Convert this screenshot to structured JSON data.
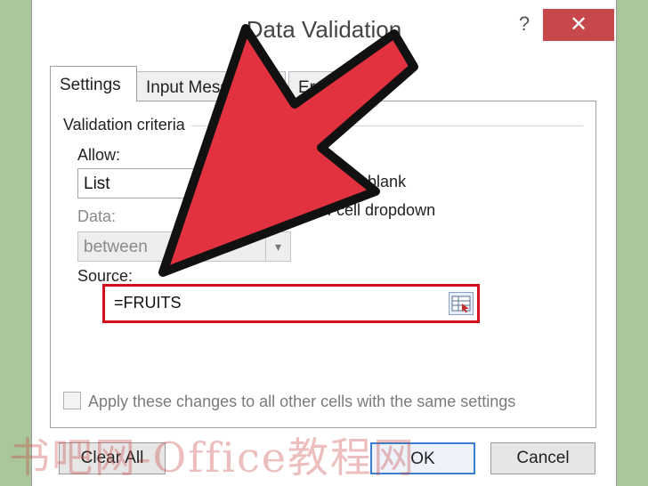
{
  "window": {
    "title": "Data Validation",
    "help_label": "?",
    "close_label": "✕"
  },
  "tabs": [
    {
      "label": "Settings",
      "active": true
    },
    {
      "label": "Input Message",
      "active": false
    },
    {
      "label": "Error Alert",
      "active": false
    }
  ],
  "settings": {
    "group_label": "Validation criteria",
    "allow": {
      "label": "Allow:",
      "value": "List"
    },
    "ignore_blank_label": "Ignore blank",
    "in_cell_dropdown_label": "In-cell dropdown",
    "data": {
      "label": "Data:",
      "value": "between"
    },
    "source": {
      "label": "Source:",
      "value": "=FRUITS"
    },
    "apply_all_label": "Apply these changes to all other cells with the same settings"
  },
  "buttons": {
    "clear_all": "Clear All",
    "ok": "OK",
    "cancel": "Cancel"
  },
  "annotation": {
    "arrow_color": "#e2313f",
    "highlight_color": "#d4101e"
  },
  "watermark": "书吧网-Office教程网"
}
